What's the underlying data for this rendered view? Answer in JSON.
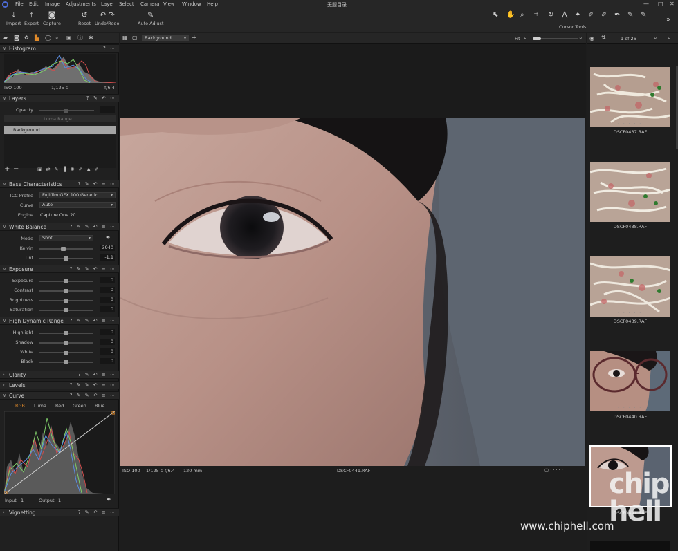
{
  "menubar": {
    "items": [
      "File",
      "Edit",
      "Image",
      "Adjustments",
      "Layer",
      "Select",
      "Camera",
      "View",
      "Window",
      "Help"
    ],
    "title": "无题目录",
    "controls": [
      "—",
      "□",
      "✕"
    ]
  },
  "toolbar": {
    "import": "Import",
    "export": "Export",
    "capture": "Capture",
    "reset": "Reset",
    "undo_redo": "Undo/Redo",
    "auto_adjust": "Auto Adjust",
    "cursor_tools": "Cursor Tools",
    "more": "»"
  },
  "histogram": {
    "title": "Histogram",
    "iso": "ISO 100",
    "shutter": "1/125 s",
    "aperture": "f/6.4"
  },
  "layers": {
    "title": "Layers",
    "opacity_label": "Opacity",
    "luma_range": "Luma Range...",
    "background_layer": "Background",
    "add": "+",
    "remove": "−"
  },
  "base": {
    "title": "Base Characteristics",
    "icc_label": "ICC Profile",
    "icc_value": "Fujifilm GFX 100 Generic",
    "curve_label": "Curve",
    "curve_value": "Auto",
    "engine_label": "Engine",
    "engine_value": "Capture One 20"
  },
  "white_balance": {
    "title": "White Balance",
    "mode_label": "Mode",
    "mode_value": "Shot",
    "kelvin_label": "Kelvin",
    "kelvin_value": "3940",
    "tint_label": "Tint",
    "tint_value": "-1.1"
  },
  "exposure": {
    "title": "Exposure",
    "rows": [
      {
        "label": "Exposure",
        "value": "0"
      },
      {
        "label": "Contrast",
        "value": "0"
      },
      {
        "label": "Brightness",
        "value": "0"
      },
      {
        "label": "Saturation",
        "value": "0"
      }
    ]
  },
  "hdr": {
    "title": "High Dynamic Range",
    "rows": [
      {
        "label": "Highlight",
        "value": "0"
      },
      {
        "label": "Shadow",
        "value": "0"
      },
      {
        "label": "White",
        "value": "0"
      },
      {
        "label": "Black",
        "value": "0"
      }
    ]
  },
  "clarity": {
    "title": "Clarity"
  },
  "levels": {
    "title": "Levels"
  },
  "curve": {
    "title": "Curve",
    "tabs": [
      "RGB",
      "Luma",
      "Red",
      "Green",
      "Blue"
    ],
    "input_label": "Input",
    "input_value": "1",
    "output_label": "Output",
    "output_value": "1"
  },
  "vignetting": {
    "title": "Vignetting"
  },
  "center_bar": {
    "layer_select": "Background",
    "zoom_label": "Fit"
  },
  "viewer_footer": {
    "iso": "ISO 100",
    "shutter": "1/125 s",
    "aperture": "f/6.4",
    "focal": "120 mm",
    "filename": "DSCF0441.RAF"
  },
  "browser": {
    "counter": "1 of 26",
    "thumbs": [
      {
        "name": "DSCF0437.RAF"
      },
      {
        "name": "DSCF0438.RAF"
      },
      {
        "name": "DSCF0439.RAF"
      },
      {
        "name": "DSCF0440.RAF"
      },
      {
        "name": "DSCF0441.RAF"
      }
    ]
  },
  "watermark": {
    "site": "www.chiphell.com",
    "logo": "chip hell"
  },
  "colors": {
    "accent": "#e08a2a",
    "selected_border": "#ffffff",
    "panel": "#202020"
  }
}
